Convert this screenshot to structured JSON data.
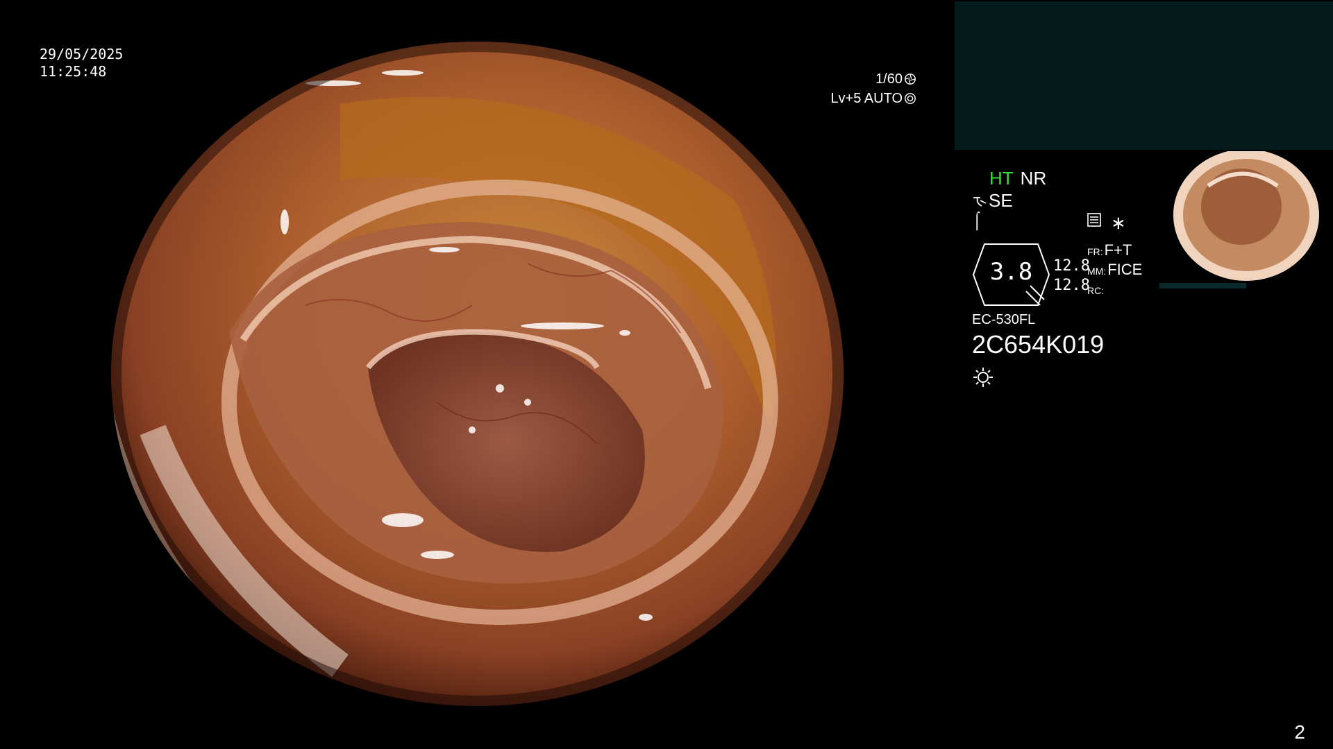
{
  "timestamp": {
    "date": "29/05/2025",
    "time": "11:25:48"
  },
  "exposure": {
    "shutter": "1/60",
    "level": "Lv+5 AUTO"
  },
  "modes": {
    "ht": "HT",
    "nr": "NR",
    "se": "SE"
  },
  "zoom": {
    "value": "3.8",
    "v1": "12.8",
    "v2": "12.8"
  },
  "settings": {
    "fr_label": "FR:",
    "fr_value": "F+T",
    "mm_label": "MM:",
    "mm_value": "FICE",
    "rc_label": "RC:",
    "rc_value": ""
  },
  "scope": {
    "model": "EC-530FL",
    "serial": "2C654K019"
  },
  "page_number": "2",
  "icons": [
    "aperture-icon",
    "auto-iris-icon",
    "scope-se-icon",
    "curve-icon",
    "memo-icon",
    "asterisk-icon",
    "light-source-icon"
  ],
  "colors": {
    "ht_green": "#3ddc3d",
    "panel_teal": "#031a1a"
  }
}
